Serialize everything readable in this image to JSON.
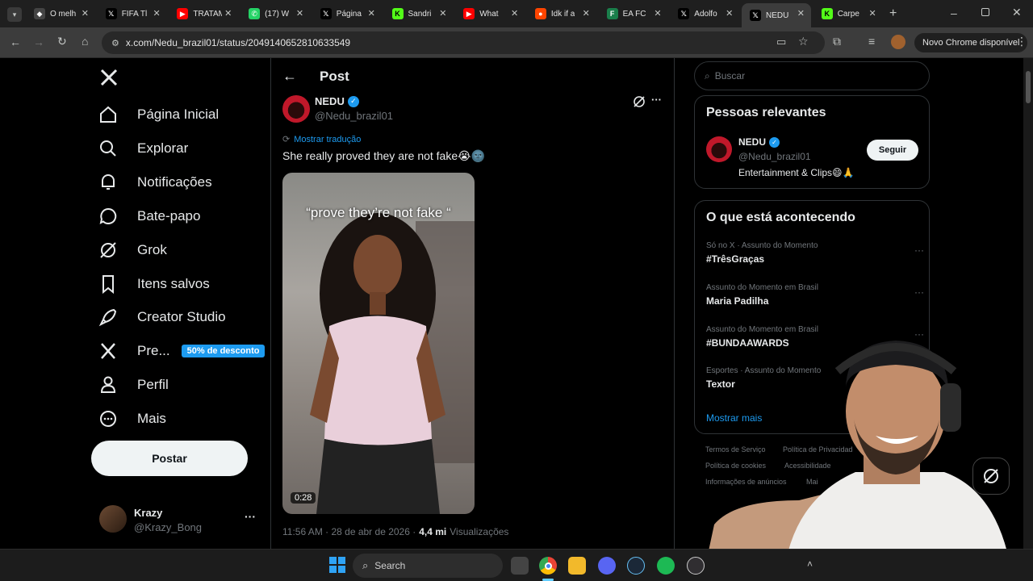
{
  "browser": {
    "tabs": [
      {
        "label": "O melh",
        "favicon": "github-icon"
      },
      {
        "label": "FIFA Tl",
        "favicon": "x-icon"
      },
      {
        "label": "TRATAM",
        "favicon": "youtube-icon"
      },
      {
        "label": "(17) W",
        "favicon": "whatsapp-icon"
      },
      {
        "label": "Página",
        "favicon": "x-icon"
      },
      {
        "label": "Sandri",
        "favicon": "kick-icon"
      },
      {
        "label": "What",
        "favicon": "youtube-icon"
      },
      {
        "label": "Idk if a",
        "favicon": "reddit-icon"
      },
      {
        "label": "EA FC",
        "favicon": "futbin-icon"
      },
      {
        "label": "Adolfo",
        "favicon": "x-icon"
      },
      {
        "label": "NEDU",
        "favicon": "x-icon"
      },
      {
        "label": "Carpe",
        "favicon": "kick-icon"
      }
    ],
    "url": "x.com/Nedu_brazil01/status/2049140652810633549",
    "new_chrome_label": "Novo Chrome disponível"
  },
  "nav": {
    "items": [
      {
        "label": "Página Inicial",
        "icon": "home-icon"
      },
      {
        "label": "Explorar",
        "icon": "search-icon"
      },
      {
        "label": "Notificações",
        "icon": "bell-icon"
      },
      {
        "label": "Bate-papo",
        "icon": "chat-icon"
      },
      {
        "label": "Grok",
        "icon": "grok-icon"
      },
      {
        "label": "Itens salvos",
        "icon": "bookmark-icon"
      },
      {
        "label": "Creator Studio",
        "icon": "rocket-icon"
      },
      {
        "label": "Pre...",
        "icon": "x-premium-icon"
      },
      {
        "label": "Perfil",
        "icon": "person-icon"
      },
      {
        "label": "Mais",
        "icon": "more-circle-icon"
      }
    ],
    "promo_badge": "50% de desconto",
    "post_button": "Postar",
    "account": {
      "name": "Krazy",
      "handle": "@Krazy_Bong"
    }
  },
  "post": {
    "header_title": "Post",
    "author_name": "NEDU",
    "author_handle": "@Nedu_brazil01",
    "translate_label": "Mostrar tradução",
    "text": "She really proved they are not fake😭🌚",
    "video_caption": "“prove they’re not fake “",
    "video_duration": "0:28",
    "timestamp": "11:56 AM · 28 de abr de 2026 ·",
    "views_count": "4,4 mi",
    "views_label": "Visualizações"
  },
  "sidebar": {
    "search_placeholder": "Buscar",
    "relevant": {
      "title": "Pessoas relevantes",
      "name": "NEDU",
      "handle": "@Nedu_brazil01",
      "bio": "Entertainment & Clips😄🙏",
      "follow_label": "Seguir"
    },
    "trends": {
      "title": "O que está acontecendo",
      "items": [
        {
          "category": "Só no X · Assunto do Momento",
          "name": "#TrêsGraças"
        },
        {
          "category": "Assunto do Momento em Brasil",
          "name": "Maria Padilha"
        },
        {
          "category": "Assunto do Momento em Brasil",
          "name": "#BUNDAAWARDS"
        },
        {
          "category": "Esportes · Assunto do Momento",
          "name": "Textor"
        }
      ],
      "show_more": "Mostrar mais"
    },
    "footer": {
      "links": [
        "Termos de Serviço",
        "Política de Privacidad",
        "Política de cookies",
        "Acessibilidade",
        "Informações de anúncios",
        "Mai"
      ]
    }
  },
  "taskbar": {
    "search_label": "Search",
    "apps": [
      "windows-start-icon",
      "widgets-icon",
      "task-view-icon",
      "chrome-icon",
      "file-explorer-icon",
      "discord-icon",
      "steam-icon",
      "spotify-icon",
      "obs-icon"
    ]
  },
  "colors": {
    "accent": "#1d9bf0",
    "background": "#000000",
    "border": "#2f3336",
    "muted": "#71767b"
  }
}
